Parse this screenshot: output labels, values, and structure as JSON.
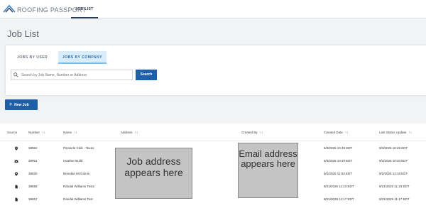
{
  "brand": {
    "small": "",
    "name": "ROOFING PASSPORT"
  },
  "nav": {
    "active_tab": "JOB LIST",
    "right_edge": ""
  },
  "page": {
    "title": "Job List"
  },
  "tabs": [
    {
      "label": "JOBS BY USER",
      "active": false
    },
    {
      "label": "JOBS BY COMPANY",
      "active": true
    }
  ],
  "search": {
    "placeholder": "Search by Job Name, Number or Address",
    "value": "",
    "button": "Search"
  },
  "actions": {
    "new_job": "New Job",
    "new_job_icon": "plus-icon"
  },
  "table": {
    "columns": [
      {
        "label": "Source",
        "sortable": false
      },
      {
        "label": "Number",
        "sortable": true
      },
      {
        "label": "Name",
        "sortable": true
      },
      {
        "label": "Address",
        "sortable": true
      },
      {
        "label": "Created By",
        "sortable": true
      },
      {
        "label": "Created Date",
        "sortable": true
      },
      {
        "label": "Last Status Update",
        "sortable": true
      }
    ],
    "rows": [
      {
        "source": "location-pin-icon",
        "number": "38962",
        "name": "Pinnacle Club - Texas",
        "created_date": "9/3/2025 10:49 EDT",
        "last_update": "9/3/2025 10:49 EDT"
      },
      {
        "source": "camera-icon",
        "number": "38961",
        "name": "Heather Build",
        "created_date": "9/3/2025 10:40 EDT",
        "last_update": "9/3/2025 10:40 EDT"
      },
      {
        "source": "location-pin-icon",
        "number": "38930",
        "name": "Brendan McGinnis",
        "created_date": "9/2/2025 11:53 EDT",
        "last_update": "9/2/2025 12:18 EDT"
      },
      {
        "source": "document-icon",
        "number": "38659",
        "name": "Randal Williams Test1",
        "created_date": "8/21/2025 11:23 EDT",
        "last_update": "8/21/2025 11:23 EDT"
      },
      {
        "source": "document-icon",
        "number": "38657",
        "name": "Randal Williams Test",
        "created_date": "8/21/2025 11:17 EDT",
        "last_update": "8/21/2025 11:17 EDT"
      }
    ]
  },
  "callouts": {
    "address": "Job address appears here",
    "email": "Email address appears here"
  },
  "colors": {
    "primary": "#1f5fa8",
    "tab_active_bg": "#d8ecfa",
    "callout_bg": "#c4c4c4"
  }
}
